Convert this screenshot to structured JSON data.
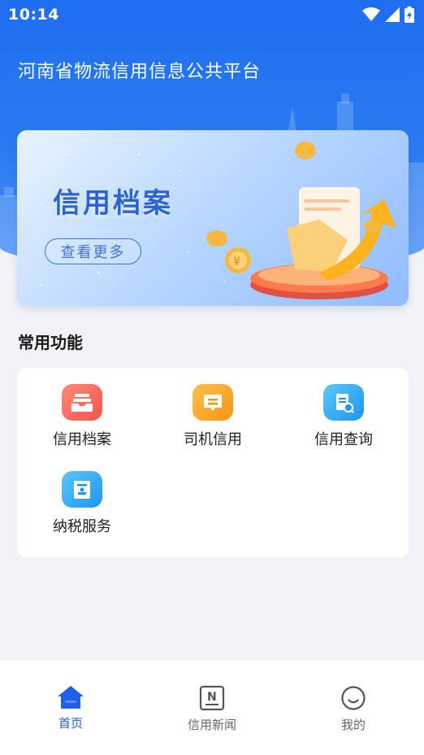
{
  "status_bar": {
    "time": "10:14"
  },
  "header": {
    "title": "河南省物流信用信息公共平台"
  },
  "banner": {
    "title": "信用档案",
    "button_label": "查看更多"
  },
  "functions": {
    "section_title": "常用功能",
    "items": [
      {
        "label": "信用档案",
        "icon": "archive-box-icon",
        "color": "#f7655b"
      },
      {
        "label": "司机信用",
        "icon": "message-card-icon",
        "color": "#f7a21b"
      },
      {
        "label": "信用查询",
        "icon": "document-search-icon",
        "color": "#29a7f2"
      },
      {
        "label": "纳税服务",
        "icon": "tax-stamp-icon",
        "color": "#29a7f2"
      }
    ]
  },
  "tabbar": {
    "active_color": "#2060e8",
    "items": [
      {
        "label": "首页",
        "icon": "home-icon",
        "active": true
      },
      {
        "label": "信用新闻",
        "icon": "news-icon",
        "active": false
      },
      {
        "label": "我的",
        "icon": "smile-face-icon",
        "active": false
      }
    ]
  }
}
